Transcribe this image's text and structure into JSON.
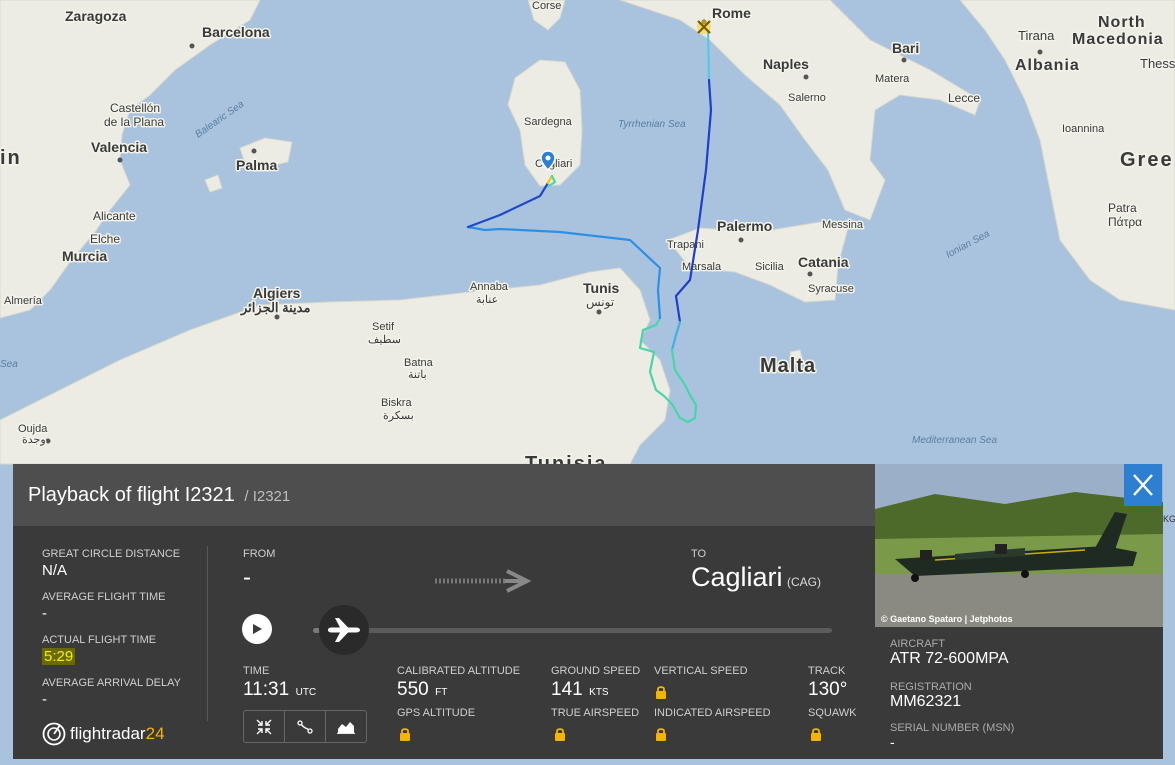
{
  "map": {
    "cities": [
      {
        "id": "zaragoza",
        "name": "Zaragoza"
      },
      {
        "id": "barcelona",
        "name": "Barcelona"
      },
      {
        "id": "rome",
        "name": "Rome"
      },
      {
        "id": "naples",
        "name": "Naples"
      },
      {
        "id": "bari",
        "name": "Bari"
      },
      {
        "id": "matera",
        "name": "Matera"
      },
      {
        "id": "salerno",
        "name": "Salerno"
      },
      {
        "id": "lecce",
        "name": "Lecce"
      },
      {
        "id": "tirana",
        "name": "Tirana"
      },
      {
        "id": "north_macedonia",
        "name": "North Macedonia"
      },
      {
        "id": "albania",
        "name": "Albania"
      },
      {
        "id": "ioannina",
        "name": "Ioannina"
      },
      {
        "id": "greece",
        "name": "Gree"
      },
      {
        "id": "patra",
        "name": "Patra"
      },
      {
        "id": "patra_gr",
        "name": "Πάτρα"
      },
      {
        "id": "corse",
        "name": "Corse"
      },
      {
        "id": "sardegna",
        "name": "Sardegna"
      },
      {
        "id": "cagliari",
        "name": "Cagliari"
      },
      {
        "id": "castellon",
        "name": "Castellón"
      },
      {
        "id": "castellon2",
        "name": "de la Plana"
      },
      {
        "id": "valencia",
        "name": "Valencia"
      },
      {
        "id": "spain",
        "name": "in"
      },
      {
        "id": "palma",
        "name": "Palma"
      },
      {
        "id": "alicante",
        "name": "Alicante"
      },
      {
        "id": "elche",
        "name": "Elche"
      },
      {
        "id": "murcia",
        "name": "Murcia"
      },
      {
        "id": "almeria",
        "name": "Almería"
      },
      {
        "id": "algiers",
        "name": "Algiers"
      },
      {
        "id": "algiers_ar",
        "name": "مدينة الجزائر"
      },
      {
        "id": "annaba",
        "name": "Annaba"
      },
      {
        "id": "annaba_ar",
        "name": "عنابة"
      },
      {
        "id": "tunis",
        "name": "Tunis"
      },
      {
        "id": "tunis_ar",
        "name": "تونس"
      },
      {
        "id": "setif",
        "name": "Setif"
      },
      {
        "id": "setif_ar",
        "name": "سطيف"
      },
      {
        "id": "batna",
        "name": "Batna"
      },
      {
        "id": "batna_ar",
        "name": "باتنة"
      },
      {
        "id": "biskra",
        "name": "Biskra"
      },
      {
        "id": "biskra_ar",
        "name": "بسكرة"
      },
      {
        "id": "oujda",
        "name": "Oujda"
      },
      {
        "id": "oujda_ar",
        "name": "وجدة"
      },
      {
        "id": "tunisia",
        "name": "Tunisia"
      },
      {
        "id": "palermo",
        "name": "Palermo"
      },
      {
        "id": "messina",
        "name": "Messina"
      },
      {
        "id": "trapani",
        "name": "Trapani"
      },
      {
        "id": "marsala",
        "name": "Marsala"
      },
      {
        "id": "sicilia",
        "name": "Sicilia"
      },
      {
        "id": "catania",
        "name": "Catania"
      },
      {
        "id": "syracuse",
        "name": "Syracuse"
      },
      {
        "id": "malta",
        "name": "Malta"
      }
    ],
    "seas": [
      {
        "id": "balearic",
        "name": "Balearic Sea"
      },
      {
        "id": "tyrrhenian",
        "name": "Tyrrhenian Sea"
      },
      {
        "id": "ionian",
        "name": "Ionian Sea"
      },
      {
        "id": "mediterranean",
        "name": "Mediterranean Sea"
      },
      {
        "id": "sea_left",
        "name": "Sea"
      }
    ]
  },
  "panel": {
    "title": "Playback of flight I2321",
    "subtitle": "/ I2321",
    "great_circle_label": "GREAT CIRCLE DISTANCE",
    "great_circle_value": "N/A",
    "avg_flight_time_label": "AVERAGE FLIGHT TIME",
    "avg_flight_time_value": "-",
    "actual_flight_time_label": "ACTUAL FLIGHT TIME",
    "actual_flight_time_value": "5:29",
    "avg_arrival_delay_label": "AVERAGE ARRIVAL DELAY",
    "avg_arrival_delay_value": "-",
    "logo_text": "flightradar",
    "logo_num": "24",
    "from_label": "FROM",
    "from_value": "-",
    "to_label": "TO",
    "to_value": "Cagliari",
    "to_code": "(CAG)",
    "playback_progress": 0.06,
    "time_label": "TIME",
    "time_value": "11:31",
    "time_unit": "UTC",
    "cal_alt_label": "CALIBRATED ALTITUDE",
    "cal_alt_value": "550",
    "cal_alt_unit": "FT",
    "gps_alt_label": "GPS ALTITUDE",
    "ground_speed_label": "GROUND SPEED",
    "ground_speed_value": "141",
    "ground_speed_unit": "KTS",
    "true_airspeed_label": "TRUE AIRSPEED",
    "vertical_speed_label": "VERTICAL SPEED",
    "indicated_airspeed_label": "INDICATED AIRSPEED",
    "track_label": "TRACK",
    "track_value": "130°",
    "squawk_label": "SQUAWK"
  },
  "aircraft": {
    "photo_credit": "© Gaetano Spataro | Jetphotos",
    "aircraft_label": "AIRCRAFT",
    "aircraft_value": "ATR 72-600MPA",
    "registration_label": "REGISTRATION",
    "registration_value": "MM62321",
    "serial_label": "SERIAL NUMBER (MSN)",
    "serial_value": "-",
    "edge_text": "KG"
  },
  "colors": {
    "sea": "#a9c3de",
    "land": "#ecece4",
    "panel": "#3a3a3a",
    "header": "#4e4e4e",
    "accent": "#2d7fd1",
    "lock": "#f5b400",
    "highlight": "#e8e600"
  },
  "icons": [
    "play-icon",
    "plane-icon",
    "collapse-icon",
    "route-icon",
    "chart-icon",
    "lock-icon",
    "close-icon",
    "pin-icon",
    "airport-icon",
    "arrow-icon"
  ]
}
